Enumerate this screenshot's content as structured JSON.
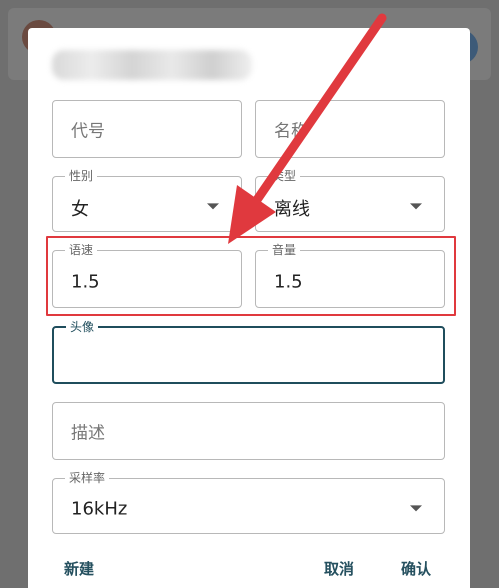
{
  "dialog": {
    "fields": {
      "code": {
        "placeholder": "代号"
      },
      "name": {
        "placeholder": "名称"
      },
      "gender": {
        "label": "性别",
        "value": "女"
      },
      "type": {
        "label": "类型",
        "value": "离线"
      },
      "speed": {
        "label": "语速",
        "value": "1.5"
      },
      "volume": {
        "label": "音量",
        "value": "1.5"
      },
      "avatar": {
        "label": "头像",
        "value": ""
      },
      "description": {
        "placeholder": "描述"
      },
      "sample_rate": {
        "label": "采样率",
        "value": "16kHz"
      }
    },
    "actions": {
      "new_label": "新建",
      "cancel_label": "取消",
      "confirm_label": "确认"
    }
  },
  "annotation": {
    "color": "#e0393e"
  },
  "colors": {
    "accent": "#1f4d5c",
    "overlay": "#6f6f6f"
  }
}
